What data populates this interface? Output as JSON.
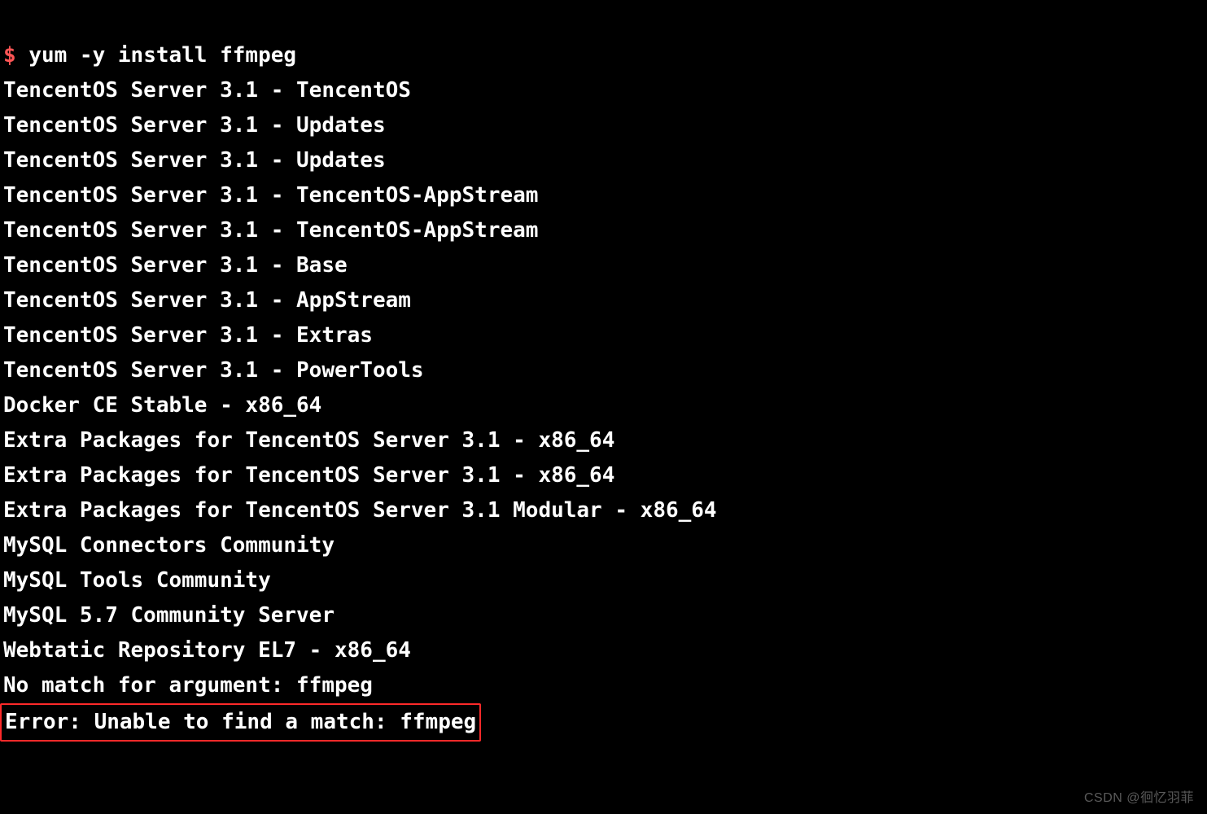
{
  "prompt": {
    "symbol": "$",
    "command": "yum -y install ffmpeg"
  },
  "output_lines": [
    "TencentOS Server 3.1 - TencentOS",
    "TencentOS Server 3.1 - Updates",
    "TencentOS Server 3.1 - Updates",
    "TencentOS Server 3.1 - TencentOS-AppStream",
    "TencentOS Server 3.1 - TencentOS-AppStream",
    "TencentOS Server 3.1 - Base",
    "TencentOS Server 3.1 - AppStream",
    "TencentOS Server 3.1 - Extras",
    "TencentOS Server 3.1 - PowerTools",
    "Docker CE Stable - x86_64",
    "Extra Packages for TencentOS Server 3.1 - x86_64",
    "Extra Packages for TencentOS Server 3.1 - x86_64",
    "Extra Packages for TencentOS Server 3.1 Modular - x86_64",
    "MySQL Connectors Community",
    "MySQL Tools Community",
    "MySQL 5.7 Community Server",
    "Webtatic Repository EL7 - x86_64"
  ],
  "nomatch_line": {
    "prefix": "No match for argument: ",
    "arg": "ffmpeg"
  },
  "error_line": "Error: Unable to find a match: ffmpeg",
  "watermark": "CSDN @徊忆羽菲"
}
